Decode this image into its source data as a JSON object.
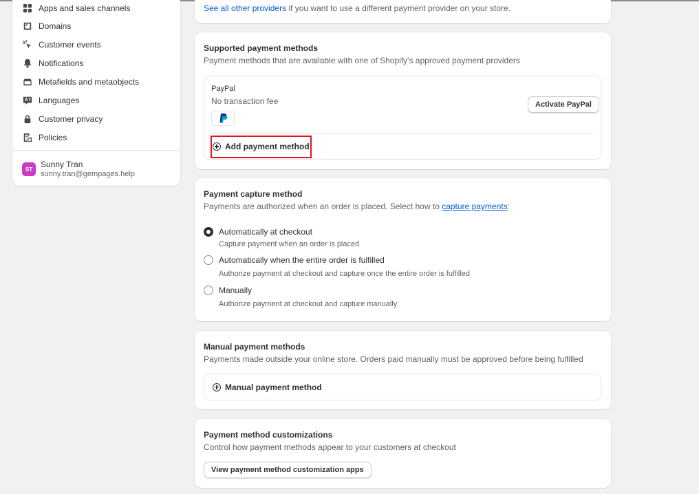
{
  "sidebar": {
    "items": [
      {
        "label": "Apps and sales channels",
        "icon": "apps-icon"
      },
      {
        "label": "Domains",
        "icon": "domains-icon"
      },
      {
        "label": "Customer events",
        "icon": "cursor-click-icon"
      },
      {
        "label": "Notifications",
        "icon": "bell-icon"
      },
      {
        "label": "Metafields and metaobjects",
        "icon": "database-icon"
      },
      {
        "label": "Languages",
        "icon": "language-icon"
      },
      {
        "label": "Customer privacy",
        "icon": "lock-icon"
      },
      {
        "label": "Policies",
        "icon": "policy-icon"
      }
    ],
    "user": {
      "initials": "ST",
      "name": "Sunny Tran",
      "email": "sunny.tran@gempages.help"
    }
  },
  "top_card": {
    "link": "See all other providers",
    "text": " if you want to use a different payment provider on your store."
  },
  "supported": {
    "title": "Supported payment methods",
    "subtitle": "Payment methods that are available with one of Shopify's approved payment providers",
    "provider_name": "PayPal",
    "provider_fee": "No transaction fee",
    "activate_button": "Activate PayPal",
    "add_method": "Add payment method"
  },
  "capture": {
    "title": "Payment capture method",
    "subtitle_before": "Payments are authorized when an order is placed. Select how to ",
    "subtitle_link": "capture payments",
    "subtitle_after": ":",
    "options": [
      {
        "label": "Automatically at checkout",
        "help": "Capture payment when an order is placed",
        "selected": true
      },
      {
        "label": "Automatically when the entire order is fulfilled",
        "help": "Authorize payment at checkout and capture once the entire order is fulfilled",
        "selected": false
      },
      {
        "label": "Manually",
        "help": "Authorize payment at checkout and capture manually",
        "selected": false
      }
    ]
  },
  "manual": {
    "title": "Manual payment methods",
    "subtitle": "Payments made outside your online store. Orders paid manually must be approved before being fulfilled",
    "button": "Manual payment method"
  },
  "customizations": {
    "title": "Payment method customizations",
    "subtitle": "Control how payment methods appear to your customers at checkout",
    "button": "View payment method customization apps"
  },
  "colors": {
    "link": "#005bd3",
    "highlight": "#e0141e",
    "avatar": "#c93cc6",
    "paypal_dark": "#003087",
    "paypal_light": "#009cde"
  }
}
